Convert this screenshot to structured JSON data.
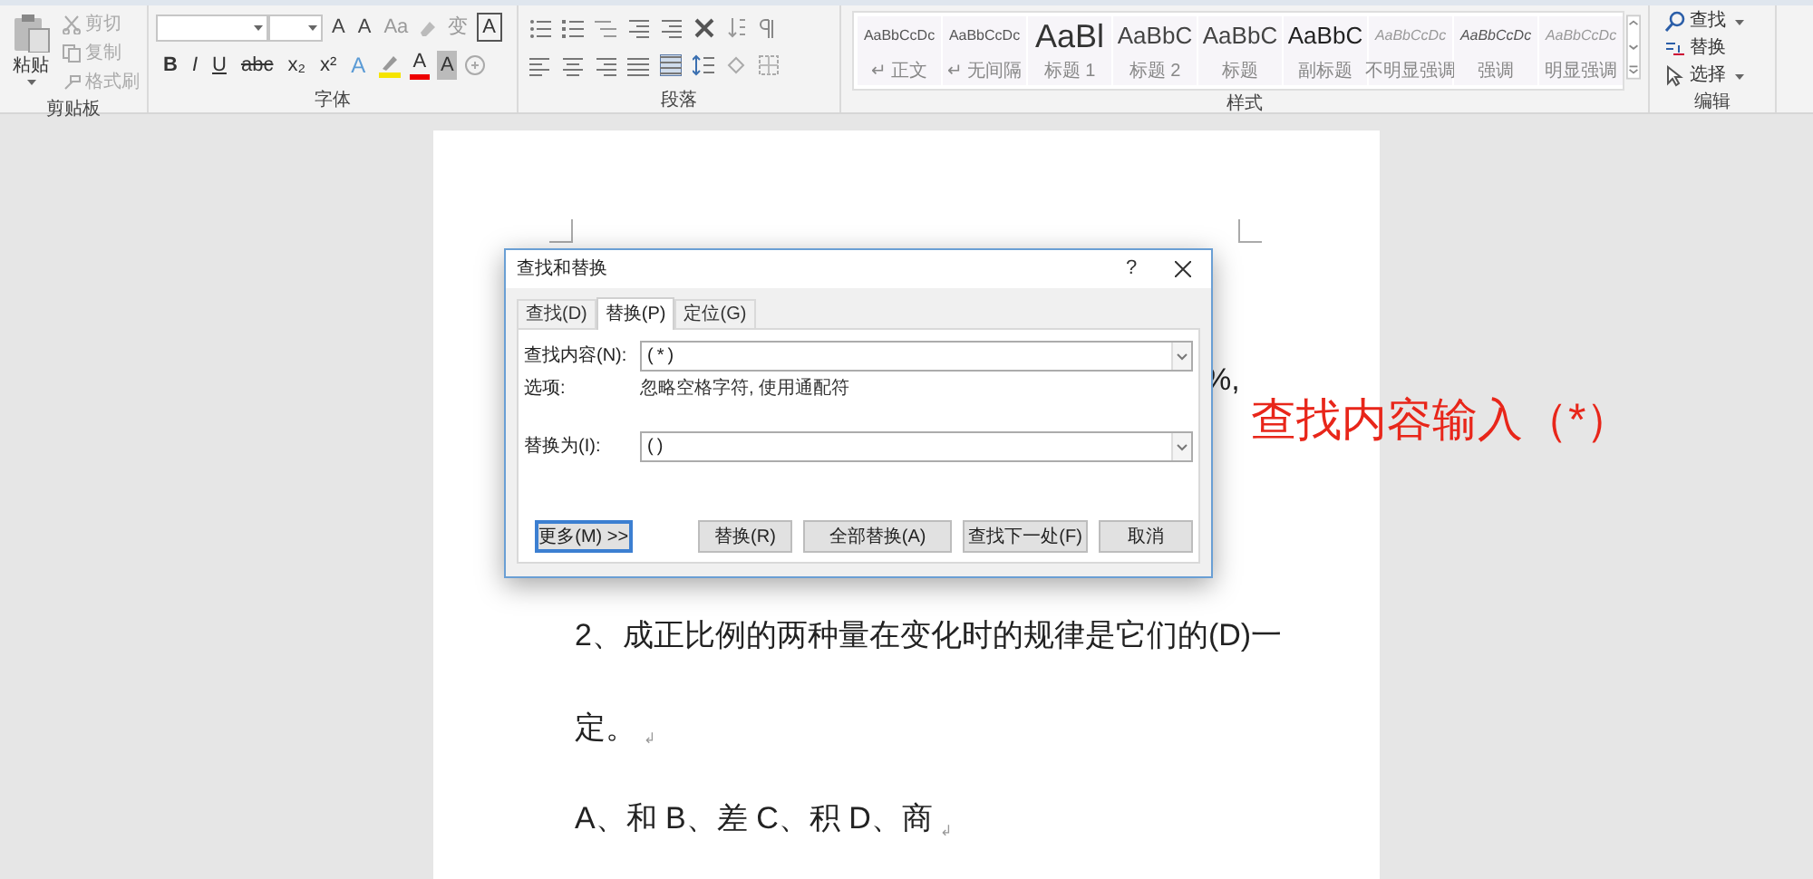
{
  "ribbon": {
    "clipboard": {
      "label": "剪贴板",
      "paste": "粘贴",
      "items": [
        {
          "kind": "cut",
          "label": "剪切",
          "disabled": true
        },
        {
          "kind": "copy",
          "label": "复制",
          "disabled": true
        },
        {
          "kind": "painter",
          "label": "格式刷",
          "disabled": true
        }
      ]
    },
    "font": {
      "label": "字体",
      "row1": [
        {
          "kind": "grow",
          "glyph": "A"
        },
        {
          "kind": "shrink",
          "glyph": "A"
        },
        {
          "kind": "case",
          "glyph": "Aa"
        },
        {
          "kind": "clear"
        },
        {
          "kind": "phonetic",
          "glyph": "变"
        },
        {
          "kind": "boxed",
          "glyph": "A"
        }
      ],
      "row2": [
        {
          "kind": "bold",
          "glyph": "B"
        },
        {
          "kind": "italic",
          "glyph": "I"
        },
        {
          "kind": "underline",
          "glyph": "U"
        },
        {
          "kind": "strike",
          "glyph": "abc"
        },
        {
          "kind": "sub",
          "glyph": "x₂"
        },
        {
          "kind": "sup",
          "glyph": "x²"
        },
        {
          "kind": "effect",
          "glyph": "A"
        },
        {
          "kind": "highlight"
        },
        {
          "kind": "color",
          "glyph": "A"
        },
        {
          "kind": "shade",
          "glyph": "A"
        },
        {
          "kind": "circle"
        }
      ]
    },
    "paragraph": {
      "label": "段落"
    },
    "styles": {
      "label": "样式",
      "items": [
        {
          "kind": "body",
          "preview": "AaBbCcDc",
          "label": "↵ 正文"
        },
        {
          "kind": "body",
          "preview": "AaBbCcDc",
          "label": "↵ 无间隔"
        },
        {
          "kind": "heading1",
          "preview": "AaBl",
          "label": "标题 1"
        },
        {
          "kind": "heading2",
          "preview": "AaBbC",
          "label": "标题 2"
        },
        {
          "kind": "title",
          "preview": "AaBbC",
          "label": "标题"
        },
        {
          "kind": "subtitle",
          "preview": "AaBbC",
          "label": "副标题"
        },
        {
          "kind": "subtle",
          "preview": "AaBbCcDc",
          "label": "不明显强调"
        },
        {
          "kind": "emphasis",
          "preview": "AaBbCcDc",
          "label": "强调"
        },
        {
          "kind": "subtle",
          "preview": "AaBbCcDc",
          "label": "明显强调"
        }
      ]
    },
    "editing": {
      "label": "编辑",
      "items": [
        {
          "kind": "find",
          "label": "查找",
          "dropdown": true
        },
        {
          "kind": "replace",
          "label": "替换",
          "dropdown": false
        },
        {
          "kind": "select",
          "label": "选择",
          "dropdown": true
        }
      ]
    }
  },
  "document": {
    "fragment": "%,",
    "lines": [
      {
        "text": "2、成正比例的两种量在变化时的规律是它们的(D)一"
      },
      {
        "text": "定。",
        "mark": "↲"
      },
      {
        "text": "A、和 B、差 C、积 D、商",
        "mark": "↲"
      }
    ]
  },
  "annotation": "查找内容输入（*）",
  "dialog": {
    "title": "查找和替换",
    "help": "?",
    "tabs": [
      {
        "label": "查找(D)",
        "selected": false
      },
      {
        "label": "替换(P)",
        "selected": true
      },
      {
        "label": "定位(G)",
        "selected": false
      }
    ],
    "find_label": "查找内容(N):",
    "find_value": "(*)",
    "options_label": "选项:",
    "options_value": "忽略空格字符, 使用通配符",
    "replace_label": "替换为(I):",
    "replace_value": "()",
    "buttons": [
      {
        "label": "更多(M) >>",
        "focused": true
      },
      {
        "label": "替换(R)",
        "focused": false
      },
      {
        "label": "全部替换(A)",
        "focused": false
      },
      {
        "label": "查找下一处(F)",
        "focused": false
      },
      {
        "label": "取消",
        "focused": false
      }
    ]
  }
}
